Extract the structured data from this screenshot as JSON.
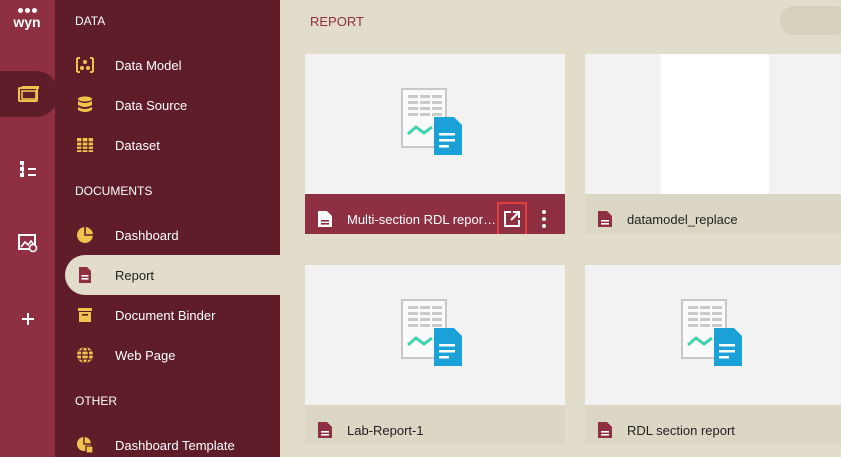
{
  "app": {
    "logo_text": "wyn"
  },
  "panel": {
    "sections": {
      "data": "DATA",
      "documents": "DOCUMENTS",
      "other": "OTHER"
    },
    "items": [
      {
        "label": "Data Model",
        "icon": "data-model-icon"
      },
      {
        "label": "Data Source",
        "icon": "database-icon"
      },
      {
        "label": "Dataset",
        "icon": "table-grid-icon"
      },
      {
        "label": "Dashboard",
        "icon": "pie-chart-icon"
      },
      {
        "label": "Report",
        "icon": "report-document-icon"
      },
      {
        "label": "Document Binder",
        "icon": "archive-box-icon"
      },
      {
        "label": "Web Page",
        "icon": "globe-icon"
      },
      {
        "label": "Dashboard Template",
        "icon": "template-icon"
      }
    ]
  },
  "main": {
    "title": "REPORT",
    "cards": [
      {
        "name": "Multi-section RDL report ...",
        "selected": true
      },
      {
        "name": "datamodel_replace",
        "selected": false
      },
      {
        "name": "Lab-Report-1",
        "selected": false
      },
      {
        "name": "RDL section report",
        "selected": false
      }
    ]
  },
  "colors": {
    "accent": "#8f2f42",
    "panel": "#5e1d29",
    "background": "#e2dccb",
    "icon_gold": "#f1c24e",
    "thumb_blue": "#1aa1d8",
    "thumb_green": "#3fd3b0",
    "highlight_red": "#e23c3c"
  }
}
